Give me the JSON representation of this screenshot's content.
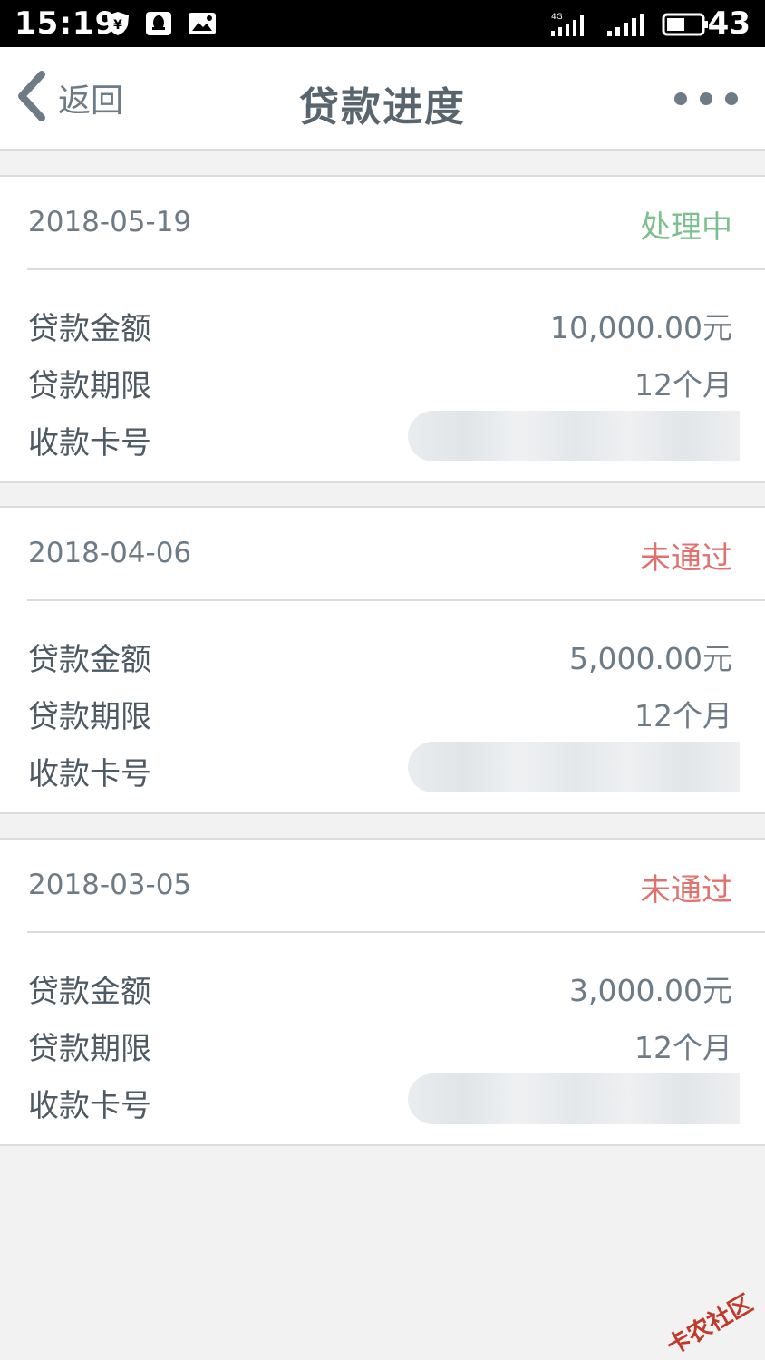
{
  "status_bar": {
    "time": "15:19",
    "battery": "43",
    "network": "4G"
  },
  "nav": {
    "back_label": "返回",
    "title": "贷款进度"
  },
  "labels": {
    "amount": "贷款金额",
    "term": "贷款期限",
    "card": "收款卡号"
  },
  "records": [
    {
      "date": "2018-05-19",
      "status": "处理中",
      "status_color": "#7dbf8f",
      "amount": "10,000.00元",
      "term": "12个月"
    },
    {
      "date": "2018-04-06",
      "status": "未通过",
      "status_color": "#e2706d",
      "amount": "5,000.00元",
      "term": "12个月"
    },
    {
      "date": "2018-03-05",
      "status": "未通过",
      "status_color": "#e2706d",
      "amount": "3,000.00元",
      "term": "12个月"
    }
  ],
  "watermark": "卡农社区"
}
